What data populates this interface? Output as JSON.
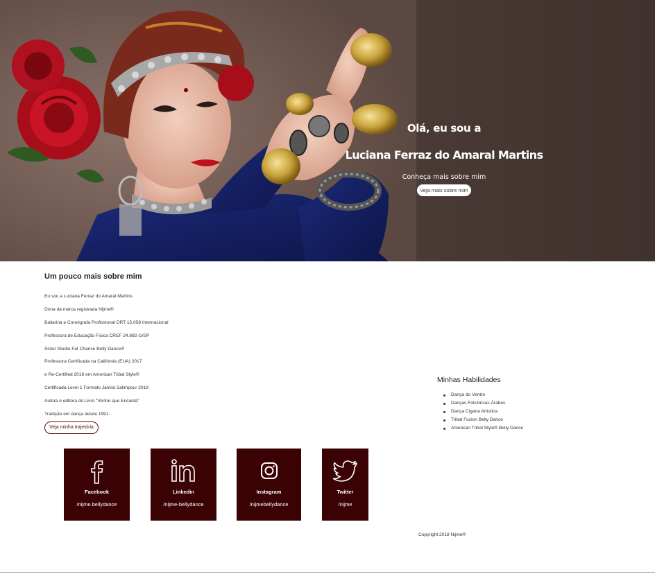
{
  "hero": {
    "greeting": "Olá, eu sou a",
    "name": "Luciana Ferraz do Amaral Martins",
    "subtitle": "Conheça mais sobre mim",
    "button_label": "Veja mais sobre mim"
  },
  "about": {
    "title": "Um pouco mais sobre mim",
    "lines": [
      "Eu sou a Luciana Ferraz do Amaral Martins",
      "Dona da marca registrada Nijme®",
      "Bailarina e Coreógrafa Profissional DRT 15.058 Internacional",
      "Professora de Educação Física CREF 24.892-G/SP",
      "Sister Studio Fat Chance Belly Dance®",
      "Professora Certificada na Califórnia (EUA) 2017",
      "e Re-Certified 2018 em American Tribal Style®",
      "Certificada Level 1 Formato Jamila Salimpour 2018",
      "Autora e editora do Livro \"Ventre que Encanta\"",
      "Tradição em dança desde 1991."
    ],
    "button_label": "Veja minha trajetória"
  },
  "skills": {
    "title": "Minhas Habilidades",
    "items": [
      "Dança do Ventre",
      "Danças Folclóricas Árabes",
      "Dança Cigana Artística",
      "Tribal Fusion Belly Dance",
      "American Tribal Style® Belly Dance"
    ]
  },
  "social": [
    {
      "name": "Facebook",
      "handle": "/nijme.bellydance",
      "icon": "facebook-icon"
    },
    {
      "name": "Linkedin",
      "handle": "/nijme-bellydance",
      "icon": "linkedin-icon"
    },
    {
      "name": "Instagram",
      "handle": "/nijmebellydance",
      "icon": "instagram-icon"
    },
    {
      "name": "Twitter",
      "handle": "/nijme",
      "icon": "twitter-icon"
    }
  ],
  "footer": {
    "copyright": "Copyright 2018 Nijme®"
  },
  "colors": {
    "social_bg": "#3b0204",
    "accent_dark_red": "#5a0c0c",
    "hero_bg": "#5c4842"
  }
}
